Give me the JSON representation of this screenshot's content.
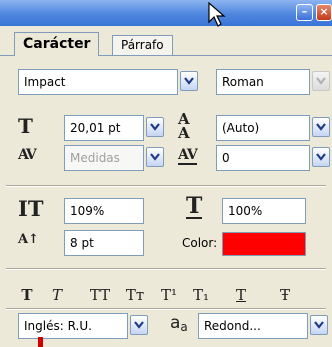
{
  "tabs": {
    "character": "Carácter",
    "paragraph": "Párrafo"
  },
  "font": {
    "family": "Impact",
    "style": "Roman"
  },
  "size": {
    "value": "20,01 pt"
  },
  "leading": {
    "value": "(Auto)"
  },
  "kerning": {
    "value": "Medidas"
  },
  "tracking": {
    "value": "0"
  },
  "vertical_scale": {
    "value": "109%"
  },
  "horizontal_scale": {
    "value": "100%"
  },
  "baseline_shift": {
    "value": "8 pt"
  },
  "color": {
    "label": "Color:",
    "value": "#ff0000"
  },
  "type_buttons": {
    "bold": "T",
    "italic": "T",
    "all_caps": "TT",
    "small_caps": "Tт",
    "superscript": "T¹",
    "subscript": "T₁",
    "underline": "T",
    "strikethrough": "Ŧ"
  },
  "language": {
    "value": "Inglés: R.U."
  },
  "antialias": {
    "label": "a",
    "label_sub": "a",
    "value": "Redond..."
  }
}
